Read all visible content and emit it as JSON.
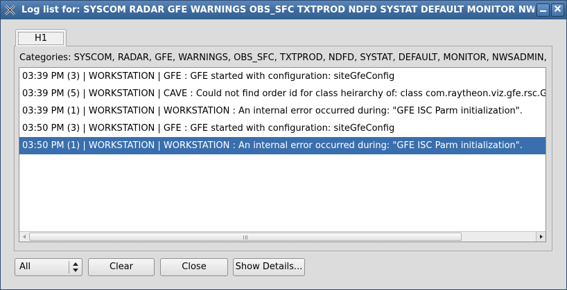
{
  "window": {
    "title": "Log list for:  SYSCOM RADAR GFE WARNINGS OBS_SFC TXTPROD NDFD SYSTAT DEFAULT MONITOR NWSADMII",
    "app_icon": "x-icon",
    "minimize_icon": "minimize-icon",
    "close_icon": "close-icon"
  },
  "tabs": [
    {
      "label": "H1",
      "selected": true
    }
  ],
  "categories_text": "Categories: SYSCOM, RADAR, GFE, WARNINGS, OBS_SFC, TXTPROD, NDFD, SYSTAT, DEFAULT, MONITOR, NWSADMIN, C",
  "log_entries": [
    {
      "text": "03:39 PM (3) | WORKSTATION | GFE : GFE started with configuration: siteGfeConfig",
      "selected": false
    },
    {
      "text": "03:39 PM (5) | WORKSTATION | CAVE : Could not find order id for class heirarchy of: class com.raytheon.viz.gfe.rsc.G",
      "selected": false
    },
    {
      "text": "03:39 PM (1) | WORKSTATION | WORKSTATION : An internal error occurred during: \"GFE ISC Parm initialization\".",
      "selected": false
    },
    {
      "text": "03:50 PM (3) | WORKSTATION | GFE : GFE started with configuration: siteGfeConfig",
      "selected": false
    },
    {
      "text": "03:50 PM (1) | WORKSTATION | WORKSTATION : An internal error occurred during: \"GFE ISC Parm initialization\".",
      "selected": true
    }
  ],
  "filter_select": {
    "value": "All"
  },
  "buttons": {
    "clear": "Clear",
    "close": "Close",
    "show_details": "Show Details..."
  },
  "colors": {
    "titlebar": "#3e6a9f",
    "selection": "#3a6fae",
    "window_bg": "#dcdcdc"
  }
}
